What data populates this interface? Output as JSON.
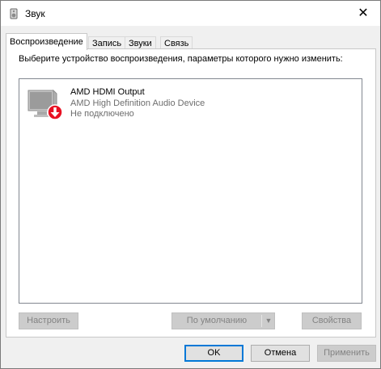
{
  "window": {
    "title": "Звук",
    "icon": "speaker-icon",
    "close_glyph": "✕"
  },
  "tabs": [
    {
      "label": "Воспроизведение",
      "active": true
    },
    {
      "label": "Запись",
      "active": false
    },
    {
      "label": "Звуки",
      "active": false
    },
    {
      "label": "Связь",
      "active": false
    }
  ],
  "playback": {
    "prompt": "Выберите устройство воспроизведения, параметры которого нужно изменить:",
    "devices": [
      {
        "name": "AMD HDMI Output",
        "description": "AMD High Definition Audio Device",
        "status": "Не подключено",
        "icon": "monitor-icon",
        "status_icon": "disconnected-badge-icon",
        "status_color": "#e81123"
      }
    ],
    "buttons": {
      "configure": "Настроить",
      "default": "По умолчанию",
      "default_arrow": "▼",
      "properties": "Свойства"
    }
  },
  "footer": {
    "ok": "OK",
    "cancel": "Отмена",
    "apply": "Применить"
  },
  "colors": {
    "focus_accent": "#0078d7",
    "disabled_text": "#838383"
  }
}
